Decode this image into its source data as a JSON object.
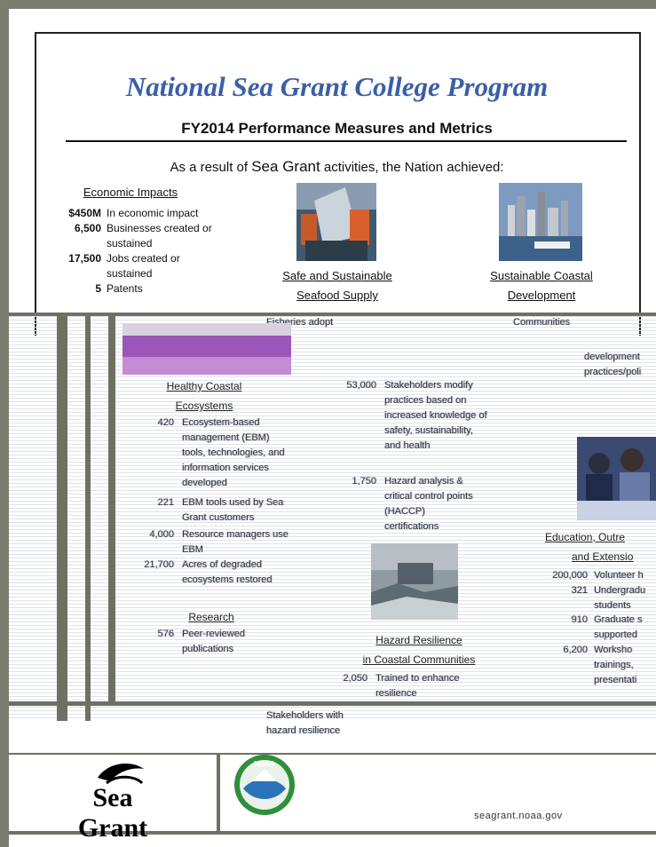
{
  "header": {
    "title": "National Sea Grant College Program",
    "subtitle": "FY2014 Performance Measures and Metrics",
    "intro_prefix": "As a result of ",
    "intro_brand": "Sea Grant",
    "intro_suffix": " activities, the Nation achieved:"
  },
  "economic": {
    "heading": "Economic Impacts",
    "items": [
      {
        "num": "$450M",
        "text": "In economic impact"
      },
      {
        "num": "6,500",
        "text": "Businesses created or sustained"
      },
      {
        "num": "17,500",
        "text": "Jobs created or sustained"
      },
      {
        "num": "5",
        "text": "Patents"
      }
    ]
  },
  "seafood": {
    "heading_line1": "Safe and Sustainable",
    "heading_line2": "Seafood Supply"
  },
  "coastal": {
    "heading_line1": "Sustainable Coastal",
    "heading_line2": "Development"
  },
  "ecosystems": {
    "heading_line1": "Healthy Coastal",
    "heading_line2": "Ecosystems",
    "items": [
      {
        "num": "420",
        "text": "Ecosystem-based management (EBM) tools, technologies, and information services developed"
      },
      {
        "num": "221",
        "text": "EBM tools used by Sea Grant customers"
      },
      {
        "num": "4,000",
        "text": "Resource managers use EBM"
      },
      {
        "num": "21,700",
        "text": "Acres of degraded ecosystems restored"
      }
    ]
  },
  "research": {
    "heading": "Research",
    "items": [
      {
        "num": "576",
        "text": "Peer-reviewed publications"
      }
    ]
  },
  "seafood_items": [
    {
      "num": "53,000",
      "text": "Stakeholders modify practices based on increased knowledge of safety, sustainability, and health"
    },
    {
      "num": "1,750",
      "text": "Hazard analysis & critical control points (HACCP) certifications"
    }
  ],
  "hazard": {
    "heading_line1": "Hazard Resilience",
    "heading_line2": "in Coastal Communities",
    "items": [
      {
        "num": "2,050",
        "text": "Trained to enhance resilience"
      }
    ]
  },
  "education": {
    "heading_line1": "Education, Outre",
    "heading_line2": "and Extensio",
    "items": [
      {
        "num": "200,000",
        "text": "Volunteer h"
      },
      {
        "num": "321",
        "text": "Undergradu students"
      },
      {
        "num": "910",
        "text": "Graduate s supported"
      },
      {
        "num": "6,200",
        "text": "Worksho trainings, presentati"
      }
    ]
  },
  "fragments": {
    "seafood_top": "Fisheries adopt",
    "coastal_top": "Communities",
    "coastal_mid": "development practices/poli",
    "bottom_line1": "Stakeholders with",
    "bottom_line2": "hazard resilience"
  },
  "footer": {
    "logo_text": "Sea Grant",
    "noaa": "NOAA",
    "url": "seagrant.noaa.gov"
  },
  "colors": {
    "title": "#3a5fa8",
    "background": "#7b7d6e"
  }
}
